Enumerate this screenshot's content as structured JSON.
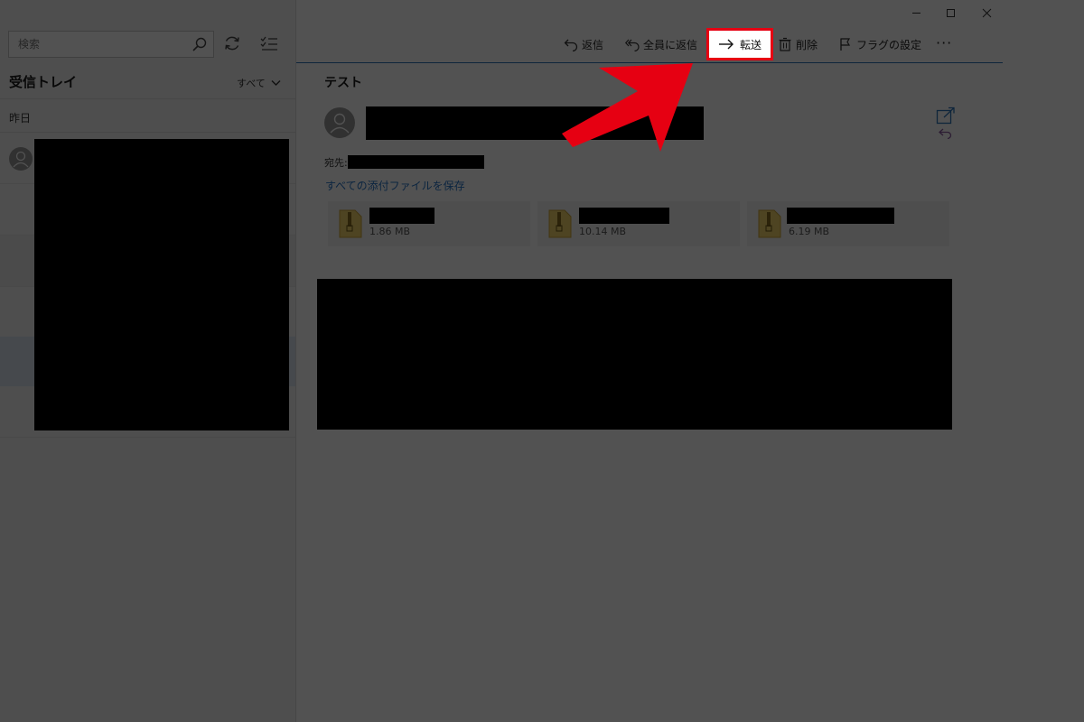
{
  "list_pane": {
    "search": {
      "placeholder": "検索"
    },
    "folder_title": "受信トレイ",
    "filter_label": "すべて",
    "group_label": "昨日"
  },
  "reading_pane": {
    "toolbar": {
      "reply": "返信",
      "reply_all": "全員に返信",
      "forward": "転送",
      "delete": "削除",
      "flag": "フラグの設定",
      "more": "···"
    },
    "subject": "テスト",
    "to_label": "宛先:",
    "save_all_attachments": "すべての添付ファイルを保存",
    "attachments": [
      {
        "size": "1.86 MB"
      },
      {
        "size": "10.14 MB"
      },
      {
        "size": "6.19 MB"
      }
    ]
  },
  "colors": {
    "accent": "#2e75b6",
    "highlight": "#e60012",
    "link": "#2673c6"
  },
  "icons": [
    "search-icon",
    "sync-icon",
    "select-mode-icon",
    "chevron-down-icon",
    "reply-icon",
    "reply-all-icon",
    "forward-arrow-icon",
    "trash-icon",
    "flag-icon",
    "more-icon",
    "person-icon",
    "popout-icon",
    "zip-file-icon",
    "minimize-icon",
    "maximize-icon",
    "close-icon",
    "annotation-arrow"
  ]
}
